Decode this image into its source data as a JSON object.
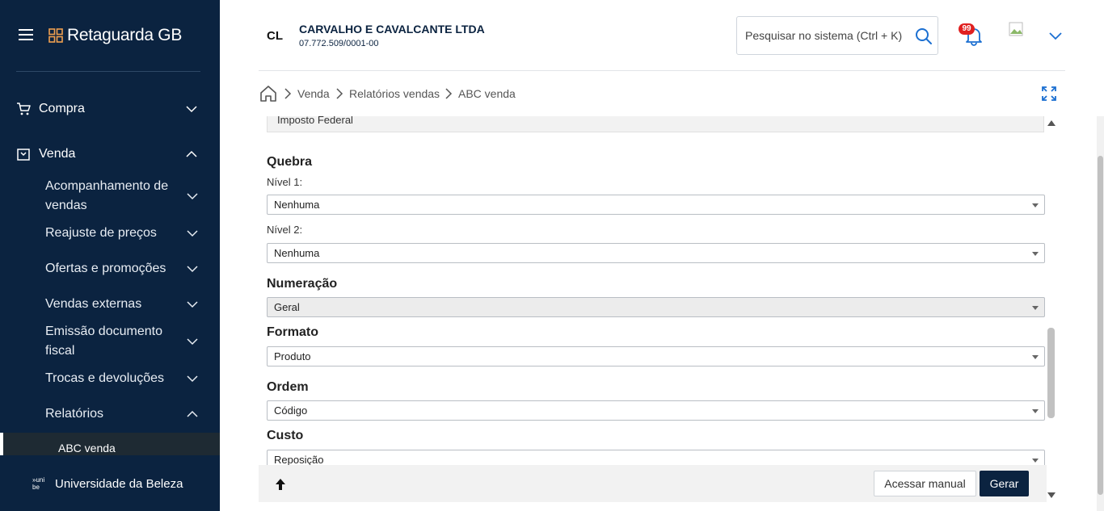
{
  "sidebar": {
    "brand": "Retaguarda GB",
    "compra_label": "Compra",
    "venda_label": "Venda",
    "sub_items": [
      {
        "label": "Acompanhamento de vendas"
      },
      {
        "label": "Reajuste de preços"
      },
      {
        "label": "Ofertas e promoções"
      },
      {
        "label": "Vendas externas"
      },
      {
        "label": "Emissão documento fiscal"
      },
      {
        "label": "Trocas e devoluções"
      },
      {
        "label": "Relatórios"
      }
    ],
    "active_item": "ABC venda",
    "footer_logo_text": "»uni be",
    "footer_label": "Universidade da Beleza"
  },
  "header": {
    "company_abbr": "CL",
    "company_name": "CARVALHO E CAVALCANTE LTDA",
    "company_cnpj": "07.772.509/0001-00",
    "search_placeholder": "Pesquisar no sistema (Ctrl + K)",
    "notification_count": "99"
  },
  "breadcrumb": [
    "Venda",
    "Relatórios vendas",
    "ABC venda"
  ],
  "form": {
    "prev_field_value": "Imposto Federal",
    "quebra_title": "Quebra",
    "nivel1_label": "Nível 1:",
    "nivel1_value": "Nenhuma",
    "nivel2_label": "Nível 2:",
    "nivel2_value": "Nenhuma",
    "numeracao_title": "Numeração",
    "numeracao_value": "Geral",
    "formato_title": "Formato",
    "formato_value": "Produto",
    "ordem_title": "Ordem",
    "ordem_value": "Código",
    "custo_title": "Custo",
    "custo_value": "Reposição"
  },
  "footer": {
    "manual_label": "Acessar manual",
    "gerar_label": "Gerar"
  },
  "colors": {
    "sidebar_bg": "#0b2340",
    "primary": "#0b2340",
    "badge": "#e02020",
    "search_icon": "#1b6fd1"
  },
  "icons": [
    "hamburger-icon",
    "brand-grid-icon",
    "cart-icon",
    "bag-icon",
    "chevron-down-icon",
    "chevron-up-icon",
    "search-icon",
    "bell-icon",
    "avatar-icon",
    "home-icon",
    "expand-icon",
    "arrow-up-icon"
  ]
}
